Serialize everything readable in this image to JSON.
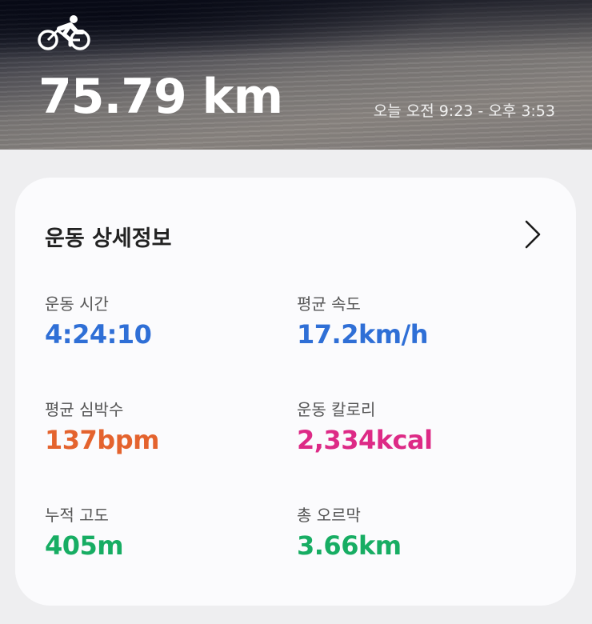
{
  "header": {
    "activity_icon": "cycling-icon",
    "distance": "75.79 km",
    "time_range": "오늘 오전 9:23 - 오후 3:53"
  },
  "details": {
    "title": "운동 상세정보",
    "more_icon": "chevron-right-icon",
    "stats": [
      {
        "label": "운동 시간",
        "value": "4:24:10",
        "color": "#2f6fd6"
      },
      {
        "label": "평균 속도",
        "value": "17.2km/h",
        "color": "#2f6fd6"
      },
      {
        "label": "평균 심박수",
        "value": "137bpm",
        "color": "#e4632e"
      },
      {
        "label": "운동 칼로리",
        "value": "2,334kcal",
        "color": "#dd2a86"
      },
      {
        "label": "누적 고도",
        "value": "405m",
        "color": "#17ad63"
      },
      {
        "label": "총 오르막",
        "value": "3.66km",
        "color": "#17ad63"
      }
    ]
  }
}
